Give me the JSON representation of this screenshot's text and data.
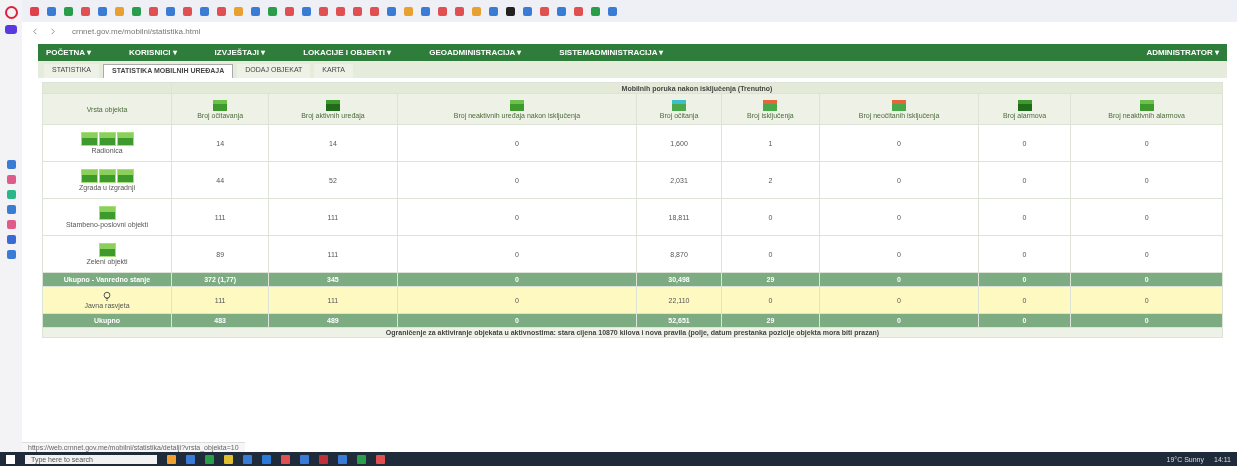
{
  "browser": {
    "bookmarks": [
      {
        "color": "#e0404a"
      },
      {
        "color": "#3a7bd5"
      },
      {
        "color": "#2a9d4a"
      },
      {
        "color": "#e05050"
      },
      {
        "color": "#3a7bd5"
      },
      {
        "color": "#e8a030"
      },
      {
        "color": "#2a9d4a"
      },
      {
        "color": "#e05050"
      },
      {
        "color": "#3a7bd5"
      },
      {
        "color": "#e05050"
      },
      {
        "color": "#3a7bd5"
      },
      {
        "color": "#e05050"
      },
      {
        "color": "#e8a030"
      },
      {
        "color": "#3a7bd5"
      },
      {
        "color": "#2a9d4a"
      },
      {
        "color": "#e05050"
      },
      {
        "color": "#3a7bd5"
      },
      {
        "color": "#e05050"
      },
      {
        "color": "#e05050"
      },
      {
        "color": "#e05050"
      },
      {
        "color": "#e05050"
      },
      {
        "color": "#3a7bd5"
      },
      {
        "color": "#e8a030"
      },
      {
        "color": "#3a7bd5"
      },
      {
        "color": "#e05050"
      },
      {
        "color": "#e05050"
      },
      {
        "color": "#e8a030"
      },
      {
        "color": "#3a7bd5"
      },
      {
        "color": "#222222"
      },
      {
        "color": "#3a7bd5"
      },
      {
        "color": "#e05050"
      },
      {
        "color": "#3a7bd5"
      },
      {
        "color": "#e05050"
      },
      {
        "color": "#2a9d4a"
      },
      {
        "color": "#3a7bd5"
      }
    ],
    "url": "crnnet.gov.me/mobilni/statistika.html",
    "status_url": "https://web.crnnet.gov.me/mobilni/statistika/detalji?vrsta_objekta=10"
  },
  "nav": {
    "items": [
      {
        "label": "POČETNA ▾"
      },
      {
        "label": "KORISNICI ▾"
      },
      {
        "label": "IZVJEŠTAJI ▾"
      },
      {
        "label": "LOKACIJE I OBJEKTI ▾"
      },
      {
        "label": "GEOADMINISTRACIJA ▾"
      },
      {
        "label": "SISTEMADMINISTRACIJA ▾"
      }
    ],
    "user": "ADMINISTRATOR ▾"
  },
  "tabs": [
    {
      "label": "STATISTIKA",
      "selected": false
    },
    {
      "label": "STATISTIKA MOBILNIH UREĐAJA",
      "selected": true
    },
    {
      "label": "DODAJ OBJEKAT",
      "selected": false
    },
    {
      "label": "KARTA",
      "selected": false
    }
  ],
  "table": {
    "group_header": "Mobilnih poruka nakon isključenja (Trenutno)",
    "corner": "Vrsta objekta",
    "columns": [
      {
        "label": "Broj očitavanja"
      },
      {
        "label": "Broj aktivnih uređaja"
      },
      {
        "label": "Broj neaktivnih uređaja nakon isključenja"
      },
      {
        "label": "Broj očitanja"
      },
      {
        "label": "Broj isključenja"
      },
      {
        "label": "Broj neočitanih isključenja"
      },
      {
        "label": "Broj alarmova"
      },
      {
        "label": "Broj neaktivnih alarmova"
      }
    ],
    "rows": [
      {
        "kind": "item",
        "label": "Radionica",
        "cells": [
          "14",
          "14",
          "0",
          "1,600",
          "1",
          "0",
          "0",
          "0"
        ]
      },
      {
        "kind": "item",
        "label": "Zgrada u izgradnji",
        "cells": [
          "44",
          "52",
          "0",
          "2,031",
          "2",
          "0",
          "0",
          "0"
        ]
      },
      {
        "kind": "item",
        "label": "Stambeno-poslovni objekti",
        "cells": [
          "111",
          "111",
          "0",
          "18,811",
          "0",
          "0",
          "0",
          "0"
        ]
      },
      {
        "kind": "item",
        "label": "Zeleni objekti",
        "cells": [
          "89",
          "111",
          "0",
          "8,870",
          "0",
          "0",
          "0",
          "0"
        ]
      },
      {
        "kind": "total",
        "label": "Ukupno - Vanredno stanje",
        "cells": [
          "372 (1,77)",
          "345",
          "0",
          "30,498",
          "29",
          "0",
          "0",
          "0"
        ]
      },
      {
        "kind": "highlight",
        "label": "Javna rasvjeta",
        "cells": [
          "111",
          "111",
          "0",
          "22,110",
          "0",
          "0",
          "0",
          "0"
        ]
      },
      {
        "kind": "total",
        "label": "Ukupno",
        "cells": [
          "483",
          "489",
          "0",
          "52,651",
          "29",
          "0",
          "0",
          "0"
        ]
      }
    ],
    "note": "Ograničenje za aktiviranje objekata u aktivnostima: stara cijena 10870 kilova i nova pravila (polje, datum prestanka pozicije objekta mora biti prazan)"
  },
  "taskbar": {
    "search_placeholder": "Type here to search",
    "weather": "19°C Sunny",
    "time": "14:11"
  }
}
